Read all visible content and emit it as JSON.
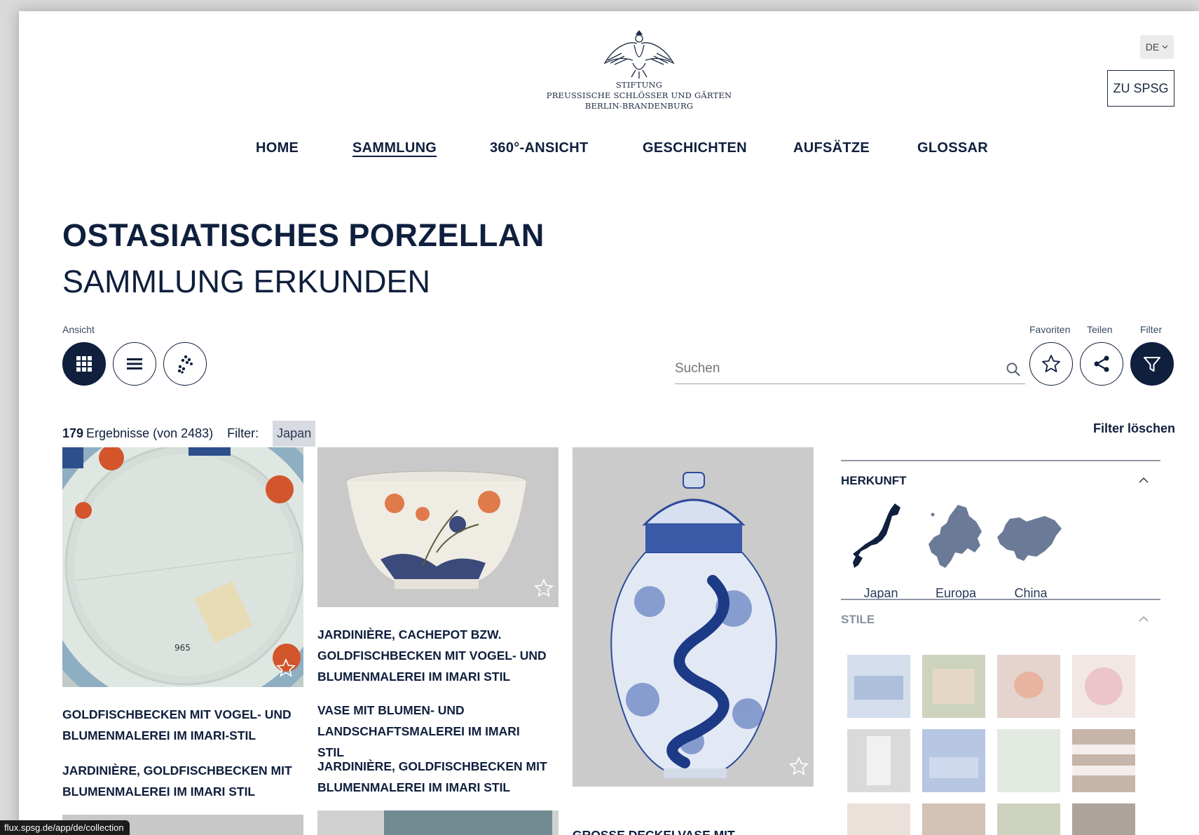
{
  "header": {
    "logo_lines": [
      "STIFTUNG",
      "PREUSSISCHE SCHLÖSSER UND GÄRTEN",
      "BERLIN-BRANDENBURG"
    ],
    "language": "DE",
    "zu_spsg": "ZU SPSG"
  },
  "nav": [
    "HOME",
    "SAMMLUNG",
    "360°-ANSICHT",
    "GESCHICHTEN",
    "AUFSÄTZE",
    "GLOSSAR"
  ],
  "nav_active": "SAMMLUNG",
  "page": {
    "title": "OSTASIATISCHES PORZELLAN",
    "subtitle": "SAMMLUNG ERKUNDEN"
  },
  "toolbar": {
    "view_label": "Ansicht",
    "view_modes": [
      "grid-icon",
      "list-icon",
      "cluster-icon"
    ],
    "search_placeholder": "Suchen",
    "favorites_label": "Favoriten",
    "share_label": "Teilen",
    "filter_label": "Filter"
  },
  "results": {
    "count": "179",
    "text": "Ergebnisse (von 2483)",
    "filter_label": "Filter:",
    "active_filter": "Japan",
    "clear_label": "Filter löschen"
  },
  "cards": {
    "col1_title1": "GOLDFISCHBECKEN MIT VOGEL- UND BLUMENMALEREI IM IMARI-STIL",
    "col1_title2": "JARDINIÈRE, GOLDFISCHBECKEN MIT BLUMENMALEREI IM IMARI STIL",
    "col2_title1": "JARDINIÈRE, CACHEPOT BZW. GOLDFISCHBECKEN MIT VOGEL- UND BLUMENMALEREI IM IMARI STIL",
    "col2_title2": "VASE MIT BLUMEN- UND LANDSCHAFTSMALEREI IM IMARI STIL",
    "col2_title3": "JARDINIÈRE, GOLDFISCHBECKEN MIT BLUMENMALEREI IM IMARI STIL",
    "col3_title1": "GROSSE DECKELVASE MIT"
  },
  "filter_panel": {
    "origin_heading": "HERKUNFT",
    "regions": [
      "Japan",
      "Europa",
      "China"
    ],
    "styles_heading": "STILE"
  },
  "status_url": "flux.spsg.de/app/de/collection",
  "colors": {
    "navy": "#0f1f3d",
    "chip": "#d7dae0",
    "map_japan": "#0f1f3d",
    "map_other": "#6b7a96"
  }
}
